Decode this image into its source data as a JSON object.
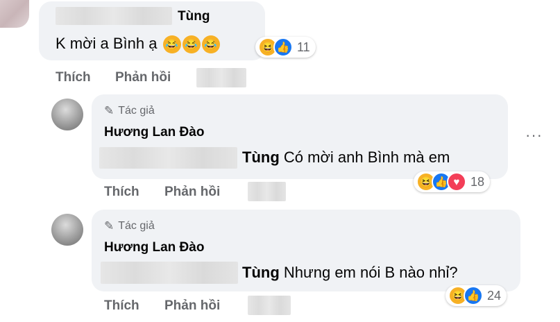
{
  "comment1": {
    "author": "Tùng",
    "text": "K mời a Bình ạ",
    "inline_emojis": [
      "face-with-tears-of-joy",
      "face-with-tears-of-joy",
      "face-with-tears-of-joy"
    ],
    "reaction_count": "11",
    "actions": {
      "like": "Thích",
      "reply": "Phản hồi"
    }
  },
  "reply1": {
    "badge": "Tác giả",
    "author": "Hương Lan Đào",
    "mention": "Tùng",
    "text": "Có mời anh Bình mà em",
    "reaction_count": "18",
    "actions": {
      "like": "Thích",
      "reply": "Phản hồi"
    }
  },
  "reply2": {
    "badge": "Tác giả",
    "author": "Hương Lan Đào",
    "mention": "Tùng",
    "text": "Nhưng em nói B nào nhỉ?",
    "reaction_count": "24",
    "actions": {
      "like": "Thích",
      "reply": "Phản hồi"
    }
  },
  "more_options": "···",
  "colors": {
    "bubble": "#f0f2f5",
    "secondary_text": "#65676b",
    "like_blue": "#1877f2",
    "haha_yellow": "#f7b125",
    "love_red": "#f33e58"
  }
}
